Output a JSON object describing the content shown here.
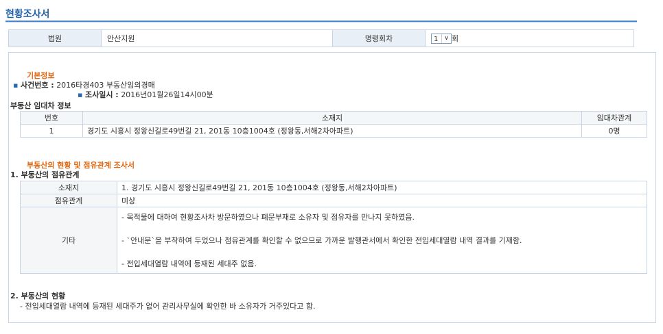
{
  "page_title": "현황조사서",
  "header": {
    "court_label": "법원",
    "court_value": "안산지원",
    "order_round_label": "명령회차",
    "order_round_value": "1",
    "order_round_unit": "회"
  },
  "basic_info": {
    "title": "기본정보",
    "case_no_label": "사건번호 :",
    "case_no_value": "2016타경403 부동산임의경매",
    "survey_date_label": "조사일시 :",
    "survey_date_value": "2016년01월26일14시00분"
  },
  "lease_info": {
    "title": "부동산 임대차 정보",
    "columns": [
      "번호",
      "소재지",
      "임대차관계"
    ],
    "rows": [
      {
        "no": "1",
        "location": "경기도 시흥시 정왕신길로49번길 21, 201동 10층1004호 (정왕동,서해2차아파트)",
        "relation": "0명"
      }
    ]
  },
  "status": {
    "title": "부동산의 현황 및 점유관계 조사서",
    "section1_title": "1. 부동산의 점유관계",
    "location_label": "소재지",
    "location_value": "1. 경기도 시흥시 정왕신길로49번길 21, 201동 10층1004호 (정왕동,서해2차아파트)",
    "occupancy_label": "점유관계",
    "occupancy_value": "미상",
    "etc_label": "기타",
    "etc_lines": [
      "- 목적물에 대하여 현황조사차 방문하였으나 폐문부재로 소유자 및 점유자를 만나지 못하였음.",
      "- `안내문`을 부착하여 두었으나 점유관계를 확인할 수 없으므로 가까운 발행관서에서 확인한 전입세대열람 내역 결과를 기재함.",
      "- 전입세대열람 내역에 등재된 세대주 없음."
    ],
    "section2_title": "2. 부동산의 현황",
    "section2_text": "- 전입세대열람 내역에 등재된 세대주가 없어 관리사무실에 확인한 바 소유자가 거주있다고 함."
  }
}
